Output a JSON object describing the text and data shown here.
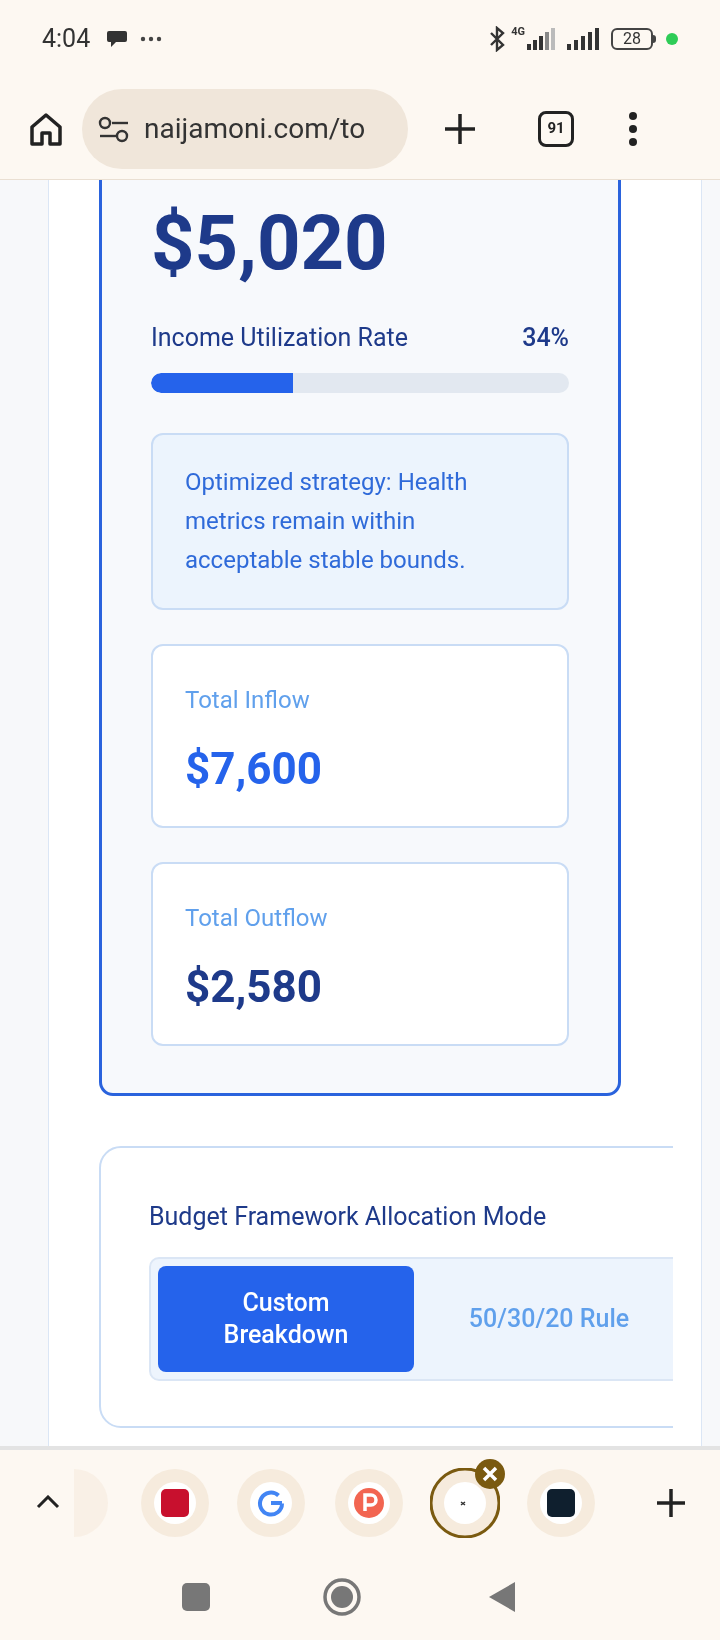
{
  "status_bar": {
    "time": "4:04",
    "network": "4G",
    "battery": "28"
  },
  "browser": {
    "url": "naijamoni.com/to",
    "tab_count": "91"
  },
  "summary": {
    "amount": "$5,020",
    "utilization_label": "Income Utilization Rate",
    "utilization_value": "34%",
    "level": 0.34,
    "note": "Optimized strategy: Health metrics remain within acceptable stable bounds.",
    "stats": [
      {
        "label": "Total Inflow",
        "value": "$7,600",
        "kind": "inflow"
      },
      {
        "label": "Total Outflow",
        "value": "$2,580",
        "kind": "outflow"
      }
    ]
  },
  "budget": {
    "title": "Budget Framework Allocation Mode",
    "modes": [
      {
        "label": "Custom Breakdown",
        "selected": true
      },
      {
        "label": "50/30/20 Rule",
        "selected": false
      }
    ]
  },
  "tab_strip": {
    "tabs": [
      {
        "kind": "partial",
        "selected": false
      },
      {
        "kind": "red",
        "selected": false
      },
      {
        "kind": "google",
        "selected": false
      },
      {
        "kind": "p",
        "selected": false
      },
      {
        "kind": "white",
        "selected": true
      },
      {
        "kind": "dark",
        "selected": false
      }
    ]
  }
}
